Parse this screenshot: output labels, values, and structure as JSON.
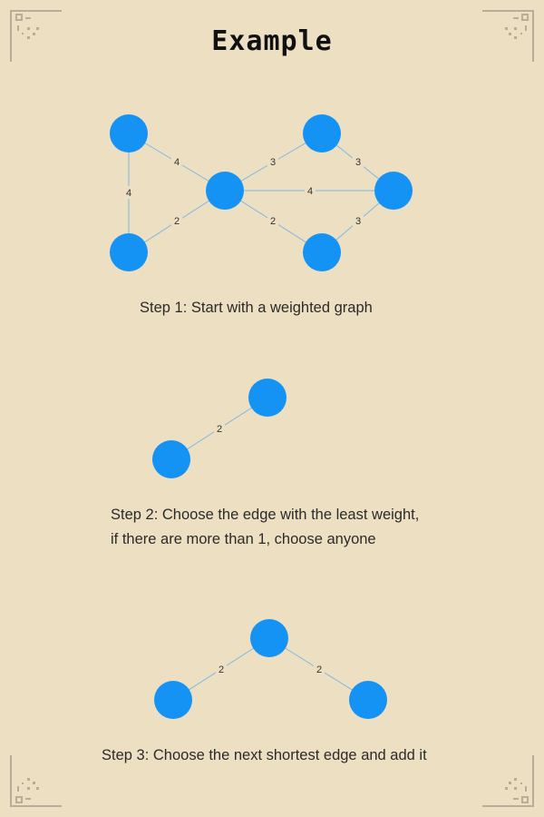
{
  "title": "Example",
  "steps": [
    {
      "caption": "Step 1: Start with a weighted graph"
    },
    {
      "caption_line1": "Step 2: Choose the edge with the least weight,",
      "caption_line2": "if there are more than 1, choose anyone"
    },
    {
      "caption": "Step 3: Choose the next shortest edge and add it"
    }
  ],
  "graph1": {
    "weights": [
      "4",
      "4",
      "2",
      "3",
      "4",
      "2",
      "3",
      "3"
    ]
  },
  "graph2": {
    "weights": [
      "2"
    ]
  },
  "graph3": {
    "weights": [
      "2",
      "2"
    ]
  },
  "colors": {
    "background": "#eddfc2",
    "node": "#1593f5",
    "edge": "#7cb7e6",
    "ornament": "#b9ad9a"
  }
}
